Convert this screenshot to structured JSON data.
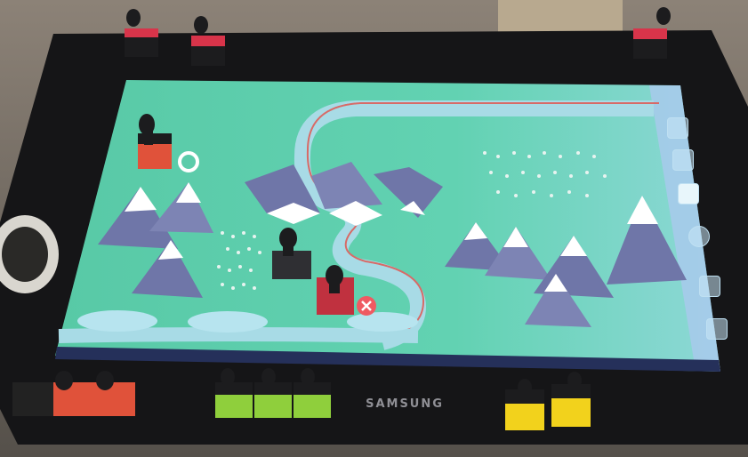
{
  "scene": {
    "device_brand": "SAMSUNG",
    "map": {
      "mountain_groups": 4,
      "forest_patches": 3,
      "rivers": 2
    },
    "sidebar": {
      "items": [
        {
          "icon": "map-tile-icon",
          "active": false
        },
        {
          "icon": "layers-icon",
          "active": false
        },
        {
          "icon": "grid-icon",
          "active": true
        },
        {
          "icon": "globe-icon",
          "active": false
        },
        {
          "icon": "arrow-icon",
          "active": false
        },
        {
          "icon": "person-icon",
          "active": false
        }
      ]
    },
    "tokens": {
      "on_table": [
        {
          "color": "#e0523a",
          "count": 1
        },
        {
          "color": "#2f2f33",
          "count": 1
        },
        {
          "color": "#c0313f",
          "count": 1
        }
      ],
      "off_table": [
        {
          "group": "top",
          "colors": [
            "#d8344a",
            "#d8344a",
            "#d8344a"
          ]
        },
        {
          "group": "bottom-left",
          "colors": [
            "#222",
            "#e0523a",
            "#e0523a"
          ]
        },
        {
          "group": "bottom-center",
          "colors": [
            "#8fcf3c",
            "#8fcf3c",
            "#8fcf3c"
          ]
        },
        {
          "group": "bottom-right",
          "colors": [
            "#f2d21c",
            "#f2d21c"
          ]
        }
      ]
    },
    "colors": {
      "screen": "#5fcfae",
      "river": "#a8dbe6",
      "mountain": "#6f76a8",
      "snow": "#ffffff"
    }
  }
}
